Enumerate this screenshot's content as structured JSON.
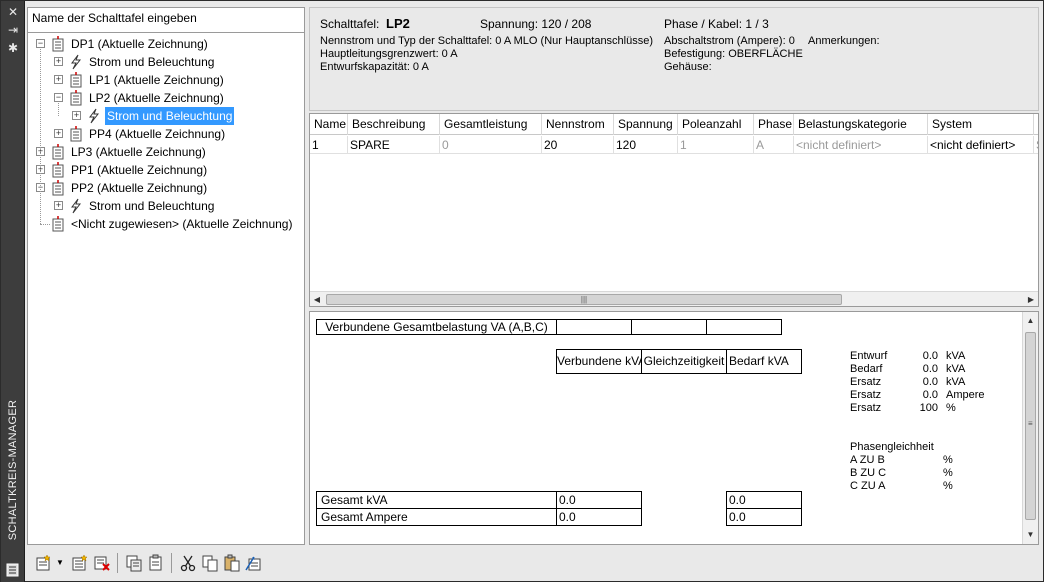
{
  "palette": {
    "title": "SCHALTKREIS-MANAGER"
  },
  "tree": {
    "header": "Name der Schalttafel eingeben",
    "nodes": [
      {
        "label": "DP1 (Aktuelle Zeichnung)",
        "icon": "panel-icon",
        "level": 0,
        "expander": "minus"
      },
      {
        "label": "Strom und Beleuchtung",
        "icon": "lightning-icon",
        "level": 1,
        "expander": "plus"
      },
      {
        "label": "LP1 (Aktuelle Zeichnung)",
        "icon": "panel-icon",
        "level": 1,
        "expander": "plus"
      },
      {
        "label": "LP2 (Aktuelle Zeichnung)",
        "icon": "panel-icon",
        "level": 1,
        "expander": "minus"
      },
      {
        "label": "Strom und Beleuchtung",
        "icon": "lightning-icon",
        "level": 2,
        "expander": "plus",
        "selected": true
      },
      {
        "label": "PP4 (Aktuelle Zeichnung)",
        "icon": "panel-icon",
        "level": 1,
        "expander": "plus"
      },
      {
        "label": "LP3 (Aktuelle Zeichnung)",
        "icon": "panel-icon",
        "level": 0,
        "expander": "plus"
      },
      {
        "label": "PP1 (Aktuelle Zeichnung)",
        "icon": "panel-icon",
        "level": 0,
        "expander": "plus"
      },
      {
        "label": "PP2 (Aktuelle Zeichnung)",
        "icon": "panel-icon",
        "level": 0,
        "expander": "minus"
      },
      {
        "label": "Strom und Beleuchtung",
        "icon": "lightning-icon",
        "level": 1,
        "expander": "plus"
      },
      {
        "label": "<Nicht zugewiesen> (Aktuelle Zeichnung)",
        "icon": "panel-icon",
        "level": 0,
        "expander": "none"
      }
    ]
  },
  "info": {
    "panel_label": "Schalttafel:",
    "panel_value": "LP2",
    "voltage": "Spannung: 120 / 208",
    "phase_wire": "Phase / Kabel:   1 /  3",
    "rating_type": "Nennstrom und Typ der Schalttafel: 0 A MLO (Nur Hauptanschlüsse)",
    "main_limit": "Hauptleitungsgrenzwert: 0 A",
    "design_capacity": "Entwurfskapazität: 0 A",
    "aic": "Abschaltstrom (Ampere):  0",
    "notes": "Anmerkungen:",
    "mounting": "Befestigung:  OBERFLÄCHE",
    "enclosure": "Gehäuse:"
  },
  "grid": {
    "columns": [
      "Name",
      "Beschreibung",
      "Gesamtleistung",
      "Nennstrom",
      "Spannung",
      "Poleanzahl",
      "Phase",
      "Belastungskategorie",
      "System",
      "S"
    ],
    "rows": [
      [
        "1",
        "SPARE",
        "0",
        "20",
        "120",
        "1",
        "A",
        "<nicht definiert>",
        "<nicht definiert>",
        "S"
      ]
    ]
  },
  "loads": {
    "connected_total_label": "Verbundene Gesamtbelastung VA (A,B,C)",
    "col_connected": "Verbundene kVA",
    "col_demand_factor": "Gleichzeitigkeit",
    "col_demand": "Bedarf kVA",
    "total_kva_label": "Gesamt kVA",
    "total_kva_connected": "0.0",
    "total_kva_demand": "0.0",
    "total_amp_label": "Gesamt Ampere",
    "total_amp_connected": "0.0",
    "total_amp_demand": "0.0",
    "summary": [
      {
        "label": "Entwurf",
        "value": "0.0",
        "unit": "kVA"
      },
      {
        "label": "Bedarf",
        "value": "0.0",
        "unit": "kVA"
      },
      {
        "label": "Ersatz",
        "value": "0.0",
        "unit": "kVA"
      },
      {
        "label": "Ersatz",
        "value": "0.0",
        "unit": "Ampere"
      },
      {
        "label": "Ersatz",
        "value": "100",
        "unit": "%"
      }
    ],
    "imbalance_title": "Phasengleichheit",
    "imbalance": [
      {
        "label": "A ZU B",
        "unit": "%"
      },
      {
        "label": "B ZU C",
        "unit": "%"
      },
      {
        "label": "C ZU A",
        "unit": "%"
      }
    ]
  },
  "toolbar": {
    "buttons": [
      "new-panel-icon",
      "dropdown-arrow-icon",
      "new-circuit-icon",
      "delete-icon",
      "copy-panel-icon",
      "paste-panel-icon",
      "cut-icon",
      "copy-icon",
      "paste-icon",
      "assign-icon"
    ]
  }
}
